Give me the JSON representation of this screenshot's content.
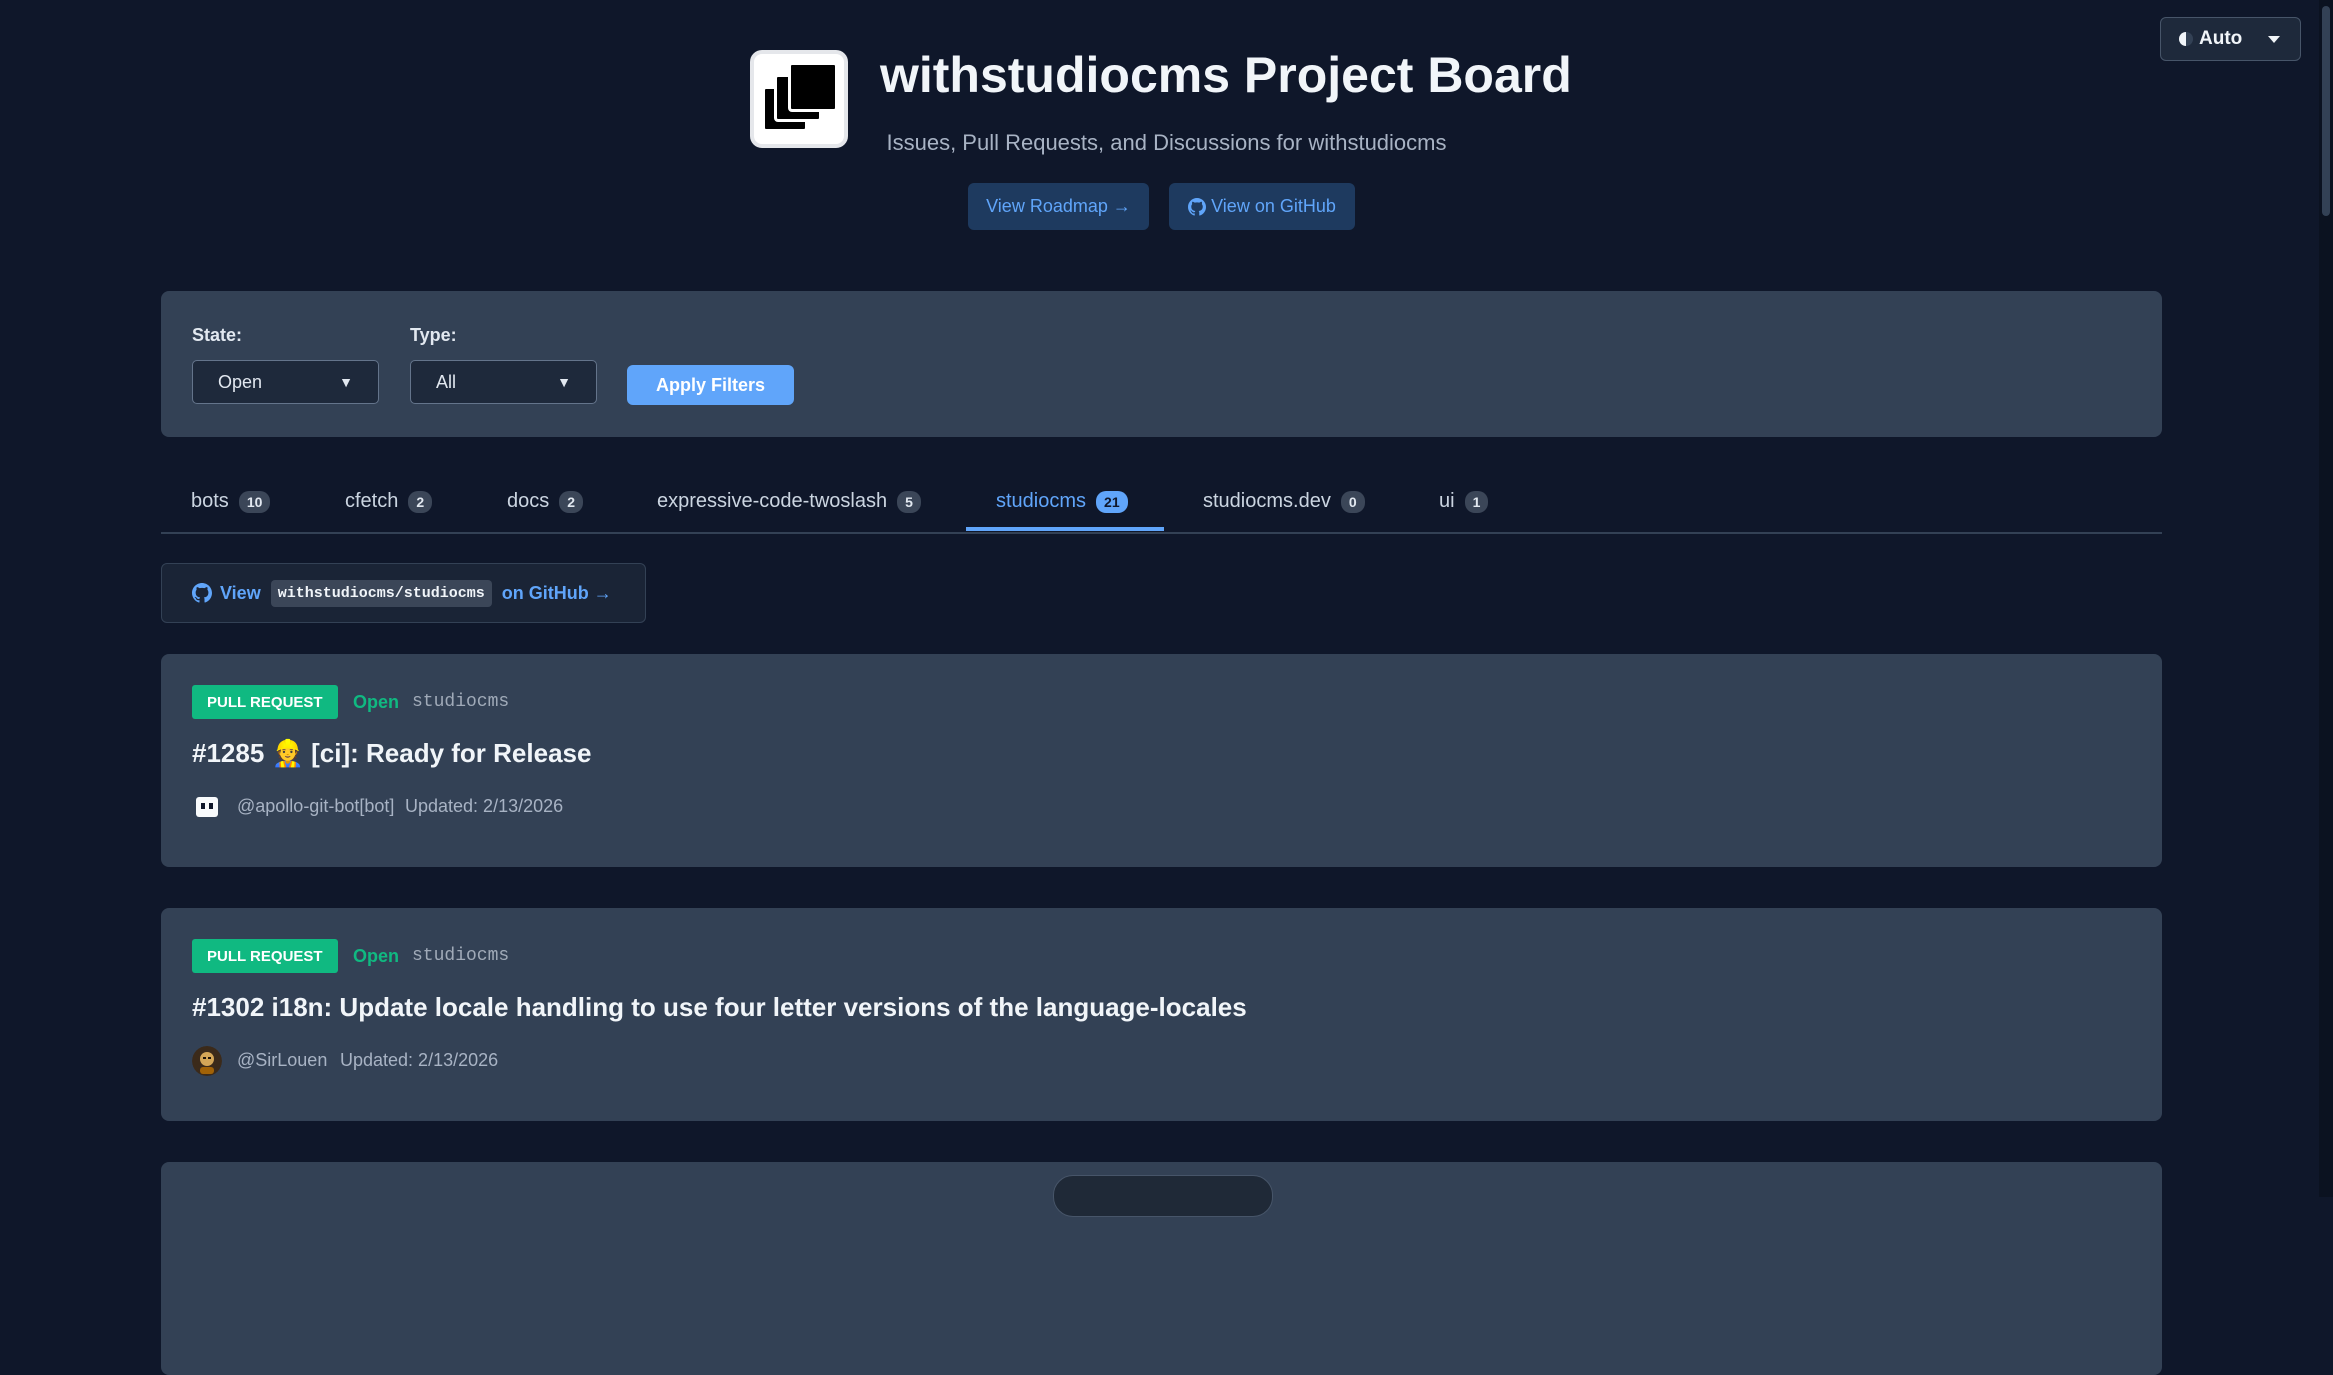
{
  "theme": {
    "label": "Auto"
  },
  "header": {
    "title": "withstudiocms Project Board",
    "subtitle": "Issues, Pull Requests, and Discussions for withstudiocms",
    "roadmap_button": "View Roadmap →",
    "github_button": "View on GitHub"
  },
  "filters": {
    "state_label": "State:",
    "state_value": "Open",
    "type_label": "Type:",
    "type_value": "All",
    "apply_button": "Apply Filters"
  },
  "tabs": [
    {
      "label": "bots",
      "count": "10"
    },
    {
      "label": "cfetch",
      "count": "2"
    },
    {
      "label": "docs",
      "count": "2"
    },
    {
      "label": "expressive-code-twoslash",
      "count": "5"
    },
    {
      "label": "studiocms",
      "count": "21",
      "active": true
    },
    {
      "label": "studiocms.dev",
      "count": "0"
    },
    {
      "label": "ui",
      "count": "1"
    }
  ],
  "repo_link": {
    "prefix": "View",
    "repo": "withstudiocms/studiocms",
    "suffix": "on GitHub →"
  },
  "cards": [
    {
      "type": "PULL REQUEST",
      "state": "Open",
      "repo": "studiocms",
      "title": "#1285 👷 [ci]: Ready for Release",
      "author": "@apollo-git-bot[bot]",
      "updated": "Updated: 2/13/2026"
    },
    {
      "type": "PULL REQUEST",
      "state": "Open",
      "repo": "studiocms",
      "title": "#1302 i18n: Update locale handling to use four letter versions of the language-locales",
      "author": "@SirLouen",
      "updated": "Updated: 2/13/2026"
    }
  ],
  "colors": {
    "background": "#0f172a",
    "panel": "#334155",
    "accent": "#60a5fa",
    "success": "#10b981"
  }
}
